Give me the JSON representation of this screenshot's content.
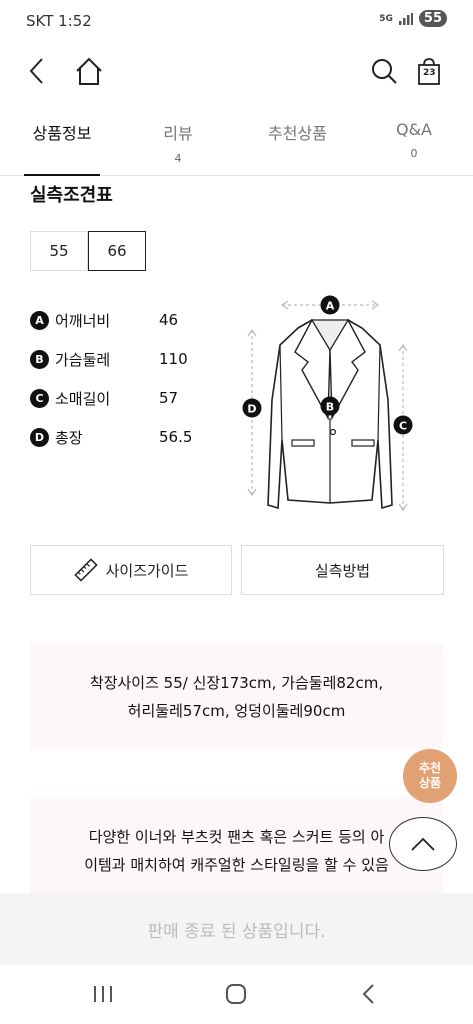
{
  "status": {
    "carrier": "SKT 1:52",
    "network": "5G",
    "battery": "55"
  },
  "nav": {
    "back_icon": "chevron-left-icon",
    "home_icon": "home-icon",
    "search_icon": "search-icon",
    "bag_icon": "shopping-bag-icon",
    "bag_count": "23"
  },
  "tabs": [
    {
      "label": "상품정보",
      "count": ""
    },
    {
      "label": "리뷰",
      "count": "4"
    },
    {
      "label": "추천상품",
      "count": ""
    },
    {
      "label": "Q&A",
      "count": "0"
    }
  ],
  "size_chart": {
    "title": "실측조견표",
    "sizes": [
      "55",
      "66"
    ],
    "selected_size": "66",
    "measurements": [
      {
        "badge": "A",
        "label": "어깨너비",
        "value": "46"
      },
      {
        "badge": "B",
        "label": "가슴둘레",
        "value": "110"
      },
      {
        "badge": "C",
        "label": "소매길이",
        "value": "57"
      },
      {
        "badge": "D",
        "label": "총장",
        "value": "56.5"
      }
    ],
    "diagram_badges": {
      "a": "A",
      "b": "B",
      "c": "C",
      "d": "D"
    }
  },
  "buttons": {
    "size_guide": "사이즈가이드",
    "measure_method": "실측방법",
    "ruler_icon": "ruler-icon"
  },
  "info": {
    "fitting_line1": "착장사이즈 55/ 신장173cm, 가슴둘레82cm,",
    "fitting_line2": "허리둘레57cm, 엉덩이둘레90cm",
    "styling_line1": "다양한 이너와 부츠컷 팬츠 혹은 스커트 등의 아",
    "styling_line2": "이템과 매치하여 캐주얼한 스타일링을 할 수 있음"
  },
  "floating": {
    "recommend_line1": "추천",
    "recommend_line2": "상품",
    "top_icon": "chevron-up-icon"
  },
  "sold_out": "판매 종료 된 상품입니다.",
  "system_nav": {
    "recents": "recents-icon",
    "home": "home-circle-icon",
    "back": "back-icon"
  }
}
